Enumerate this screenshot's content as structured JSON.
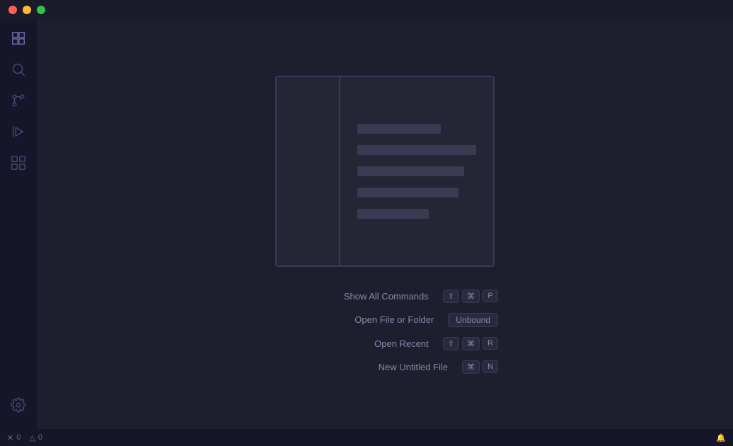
{
  "titlebar": {
    "traffic_lights": [
      "close",
      "minimize",
      "maximize"
    ]
  },
  "sidebar": {
    "items": [
      {
        "name": "explorer",
        "label": "Explorer",
        "active": true
      },
      {
        "name": "search",
        "label": "Search"
      },
      {
        "name": "source-control",
        "label": "Source Control"
      },
      {
        "name": "run-debug",
        "label": "Run and Debug"
      },
      {
        "name": "extensions",
        "label": "Extensions"
      }
    ],
    "bottom": [
      {
        "name": "settings",
        "label": "Settings"
      }
    ]
  },
  "shortcuts": [
    {
      "name": "show-all-commands",
      "label": "Show All Commands",
      "keys": [
        {
          "symbol": "⇧",
          "type": "modifier"
        },
        {
          "symbol": "⌘",
          "type": "modifier"
        },
        {
          "symbol": "P",
          "type": "key"
        }
      ]
    },
    {
      "name": "open-file-or-folder",
      "label": "Open File or Folder",
      "keys": [
        {
          "symbol": "Unbound",
          "type": "unbound"
        }
      ]
    },
    {
      "name": "open-recent",
      "label": "Open Recent",
      "keys": [
        {
          "symbol": "⇧",
          "type": "modifier"
        },
        {
          "symbol": "⌘",
          "type": "modifier"
        },
        {
          "symbol": "R",
          "type": "key"
        }
      ]
    },
    {
      "name": "new-untitled-file",
      "label": "New Untitled File",
      "keys": [
        {
          "symbol": "⌘",
          "type": "modifier"
        },
        {
          "symbol": "N",
          "type": "key"
        }
      ]
    }
  ],
  "statusbar": {
    "errors": "0",
    "warnings": "0",
    "notification_icon": "🔔"
  }
}
